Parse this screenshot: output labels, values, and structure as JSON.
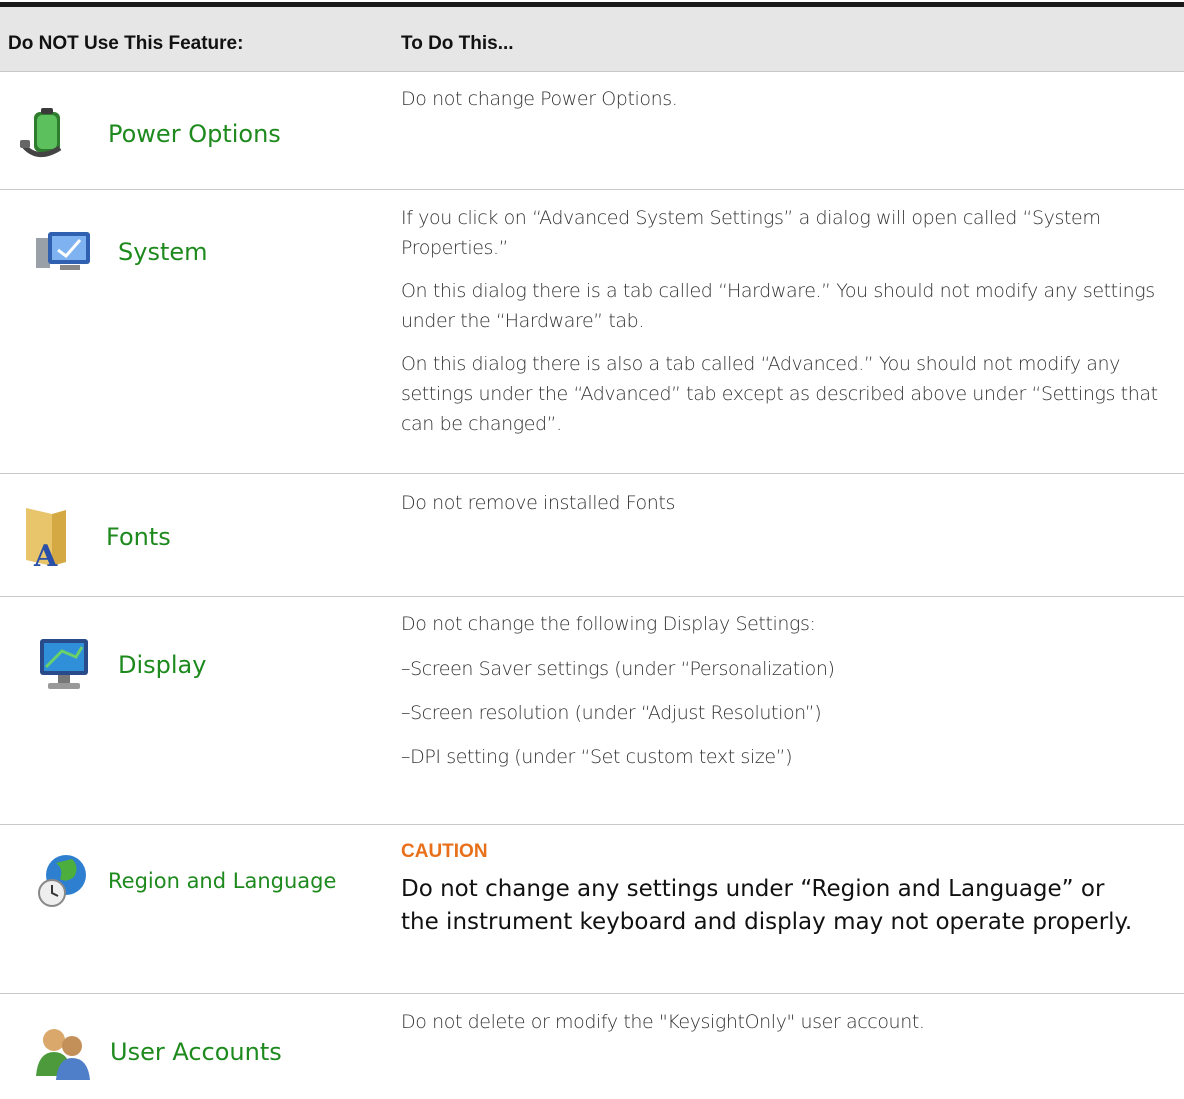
{
  "header": {
    "col1": "Do NOT Use This Feature:",
    "col2": "To Do This..."
  },
  "rows": [
    {
      "feature": "Power Options",
      "icon": "battery-plug-icon",
      "lines": [
        "Do not change Power Options."
      ]
    },
    {
      "feature": "System",
      "icon": "computer-system-icon",
      "lines": [
        "If you click on “Advanced System Settings” a dialog will open called “System Properties.”",
        "On this dialog there is a tab called “Hardware.” You should not modify any settings under the “Hardware” tab.",
        "On this dialog there is also a tab called “Advanced.” You should not modify any settings under the “Advanced” tab except as described above under “Settings that can be changed”."
      ]
    },
    {
      "feature": "Fonts",
      "icon": "fonts-folder-icon",
      "lines": [
        "Do not remove installed Fonts"
      ]
    },
    {
      "feature": "Display",
      "icon": "monitor-icon",
      "lines": [
        "Do not change the following Display Settings:",
        "–Screen Saver settings (under “Personalization)",
        "–Screen resolution (under “Adjust Resolution”)",
        "–DPI setting (under “Set custom text size”)"
      ]
    },
    {
      "feature": "Region and Language",
      "icon": "globe-clock-icon",
      "caution_title": "CAUTION",
      "caution_text": "Do not change any settings under “Region and Language” or the instrument keyboard and display may not operate properly."
    },
    {
      "feature": "User Accounts",
      "icon": "users-icon",
      "lines": [
        "Do not delete or modify the \"KeysightOnly\" user account."
      ]
    }
  ],
  "colors": {
    "feature_green": "#1e8a1e",
    "caution_orange": "#e8701a",
    "header_bg": "#e6e6e6"
  }
}
